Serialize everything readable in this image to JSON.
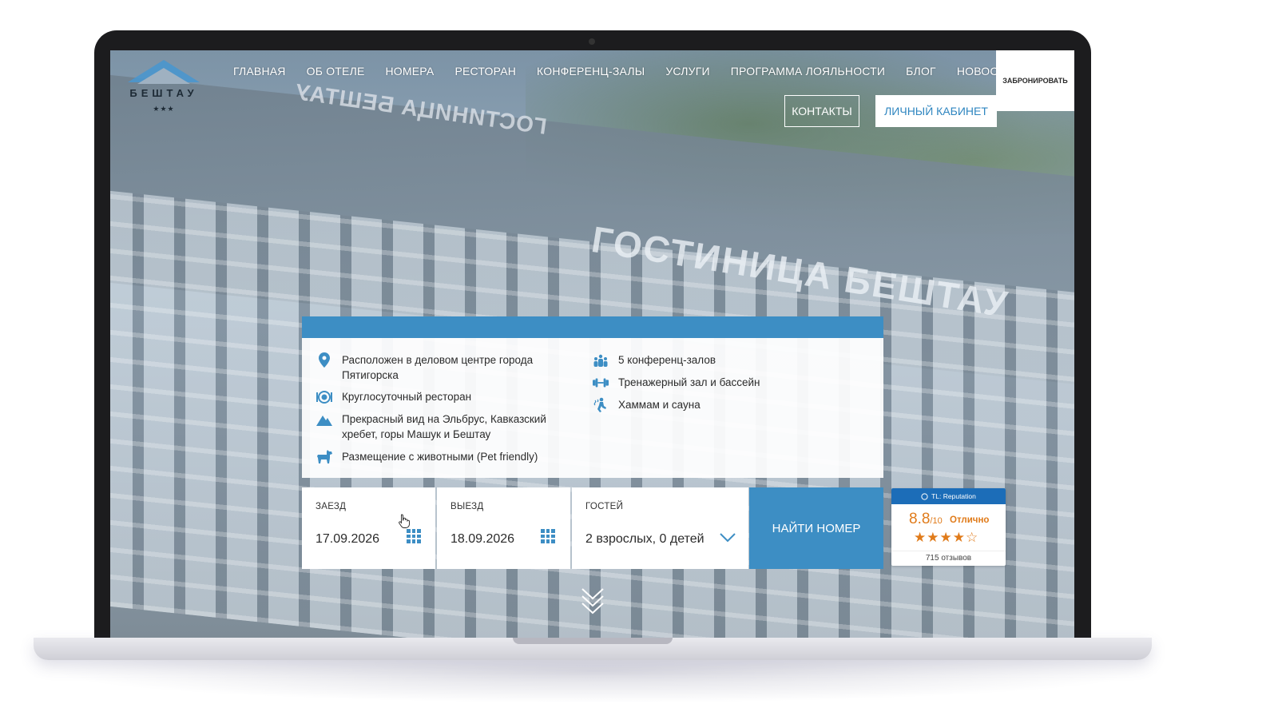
{
  "colors": {
    "accent": "#3d8ec4",
    "rating": "#e07b1a",
    "rating_header": "#1c6db8"
  },
  "photo_signs": {
    "main": "ГОСТИНИЦА БЕШТАУ",
    "back": "ГОСТИНИЦА БЕШТАУ"
  },
  "logo": {
    "name": "БЕШТАУ",
    "stars": "★★★"
  },
  "nav": {
    "items": [
      "ГЛАВНАЯ",
      "ОБ ОТЕЛЕ",
      "НОМЕРА",
      "РЕСТОРАН",
      "КОНФЕРЕНЦ-ЗАЛЫ",
      "УСЛУГИ",
      "ПРОГРАММА ЛОЯЛЬНОСТИ",
      "БЛОГ",
      "НОВОСТИ"
    ],
    "book": "ЗАБРОНИРОВАТЬ",
    "contacts": "КОНТАКТЫ",
    "cabinet": "ЛИЧНЫЙ КАБИНЕТ"
  },
  "features": {
    "left": [
      {
        "icon": "map-pin-icon",
        "text": "Расположен в деловом центре города Пятигорска"
      },
      {
        "icon": "plate-icon",
        "text": "Круглосуточный ресторан"
      },
      {
        "icon": "mountain-icon",
        "text": "Прекрасный вид на Эльбрус, Кавказский хребет, горы Машук и Бештау"
      },
      {
        "icon": "dog-icon",
        "text": "Размещение с животными (Pet friendly)"
      }
    ],
    "right": [
      {
        "icon": "people-icon",
        "text": "5 конференц-залов"
      },
      {
        "icon": "dumbbell-icon",
        "text": "Тренажерный зал и бассейн"
      },
      {
        "icon": "sauna-icon",
        "text": "Хаммам и сауна"
      }
    ]
  },
  "booking": {
    "checkin_label": "ЗАЕЗД",
    "checkin_value": "17.09.2026",
    "checkout_label": "ВЫЕЗД",
    "checkout_value": "18.09.2026",
    "guests_label": "ГОСТЕЙ",
    "guests_value": "2 взрослых, 0 детей",
    "find_button": "НАЙТИ НОМЕР"
  },
  "reputation": {
    "provider": "TL: Reputation",
    "score": "8.8",
    "scale": "/10",
    "word": "Отлично",
    "stars": "★★★★☆",
    "reviews": "715 отзывов"
  }
}
